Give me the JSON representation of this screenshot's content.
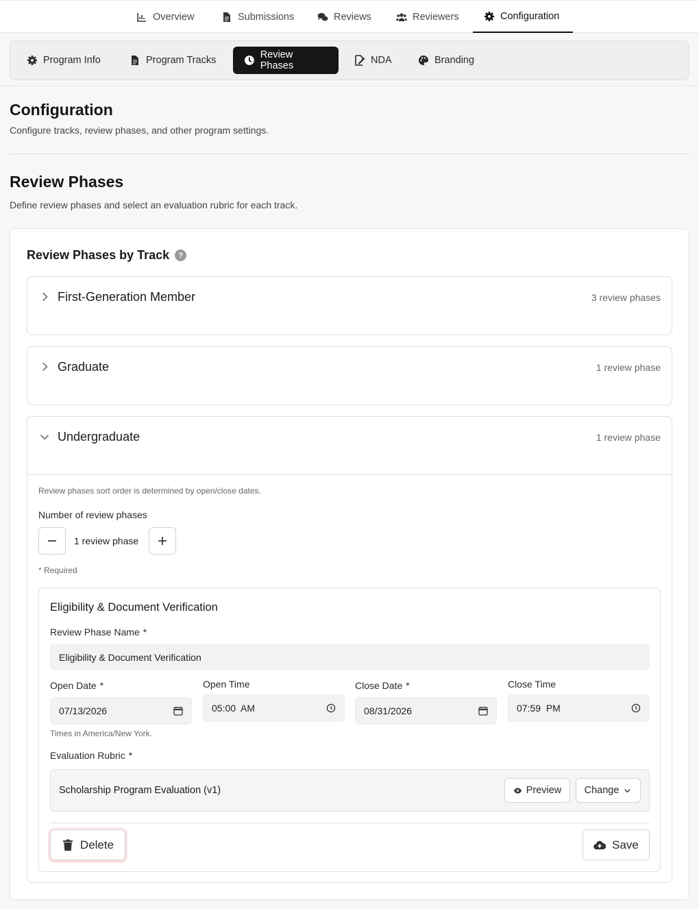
{
  "topnav": {
    "tabs": [
      {
        "label": "Overview",
        "icon": "chart-icon"
      },
      {
        "label": "Submissions",
        "icon": "document-icon"
      },
      {
        "label": "Reviews",
        "icon": "comments-icon"
      },
      {
        "label": "Reviewers",
        "icon": "users-icon"
      },
      {
        "label": "Configuration",
        "icon": "gear-icon",
        "active": true
      }
    ]
  },
  "subnav": {
    "tabs": [
      {
        "label": "Program Info",
        "icon": "gear-icon"
      },
      {
        "label": "Program Tracks",
        "icon": "document-icon"
      },
      {
        "label": "Review Phases",
        "icon": "clock-icon",
        "active": true
      },
      {
        "label": "NDA",
        "icon": "signature-icon"
      },
      {
        "label": "Branding",
        "icon": "palette-icon"
      }
    ]
  },
  "page": {
    "title": "Configuration",
    "subtitle": "Configure tracks, review phases, and other program settings."
  },
  "section": {
    "title": "Review Phases",
    "subtitle": "Define review phases and select an evaluation rubric for each track."
  },
  "card": {
    "title": "Review Phases by Track",
    "help": "?"
  },
  "tracks": [
    {
      "name": "First-Generation Member",
      "count": "3 review phases",
      "expanded": false
    },
    {
      "name": "Graduate",
      "count": "1 review phase",
      "expanded": false
    },
    {
      "name": "Undergraduate",
      "count": "1 review phase",
      "expanded": true
    }
  ],
  "undergrad": {
    "sort_note": "Review phases sort order is determined by open/close dates.",
    "num_label": "Number of review phases",
    "num_value": "1 review phase",
    "required_note": "* Required",
    "phase": {
      "title": "Eligibility & Document Verification",
      "name_label": "Review Phase Name",
      "name_value": "Eligibility & Document Verification",
      "open_date_label": "Open Date",
      "open_date_value": "07/13/2026",
      "open_time_label": "Open Time",
      "open_time_value": "05:00  AM",
      "close_date_label": "Close Date",
      "close_date_value": "08/31/2026",
      "close_time_label": "Close Time",
      "close_time_value": "07:59  PM",
      "timezone_note": "Times in America/New York.",
      "rubric_label": "Evaluation Rubric",
      "rubric_value": "Scholarship Program Evaluation (v1)",
      "preview_label": "Preview",
      "change_label": "Change",
      "delete_label": "Delete",
      "save_label": "Save",
      "star": "*"
    }
  },
  "colors": {
    "active_tab_bg": "#161616",
    "page_bg": "#f7f7f7"
  }
}
